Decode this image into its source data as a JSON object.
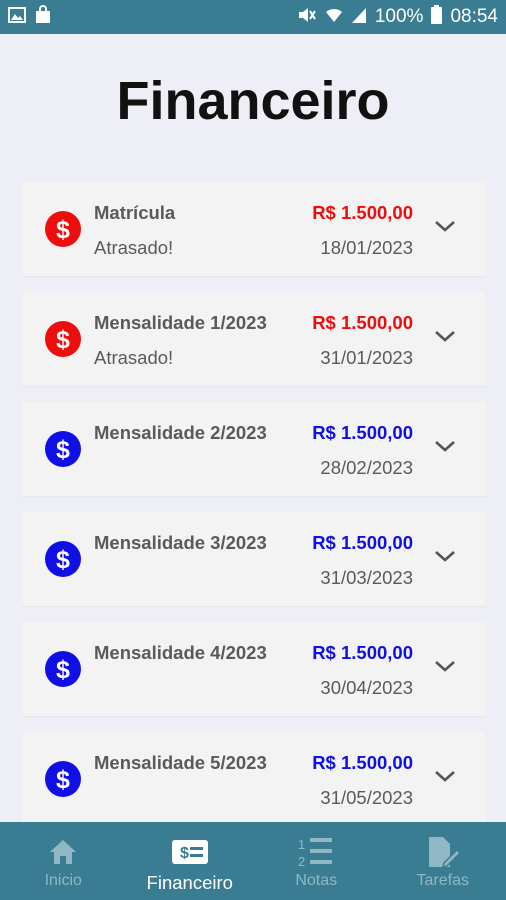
{
  "status_bar": {
    "battery": "100%",
    "time": "08:54"
  },
  "page": {
    "title": "Financeiro"
  },
  "colors": {
    "overdue": "#ee0d0d",
    "pending": "#1010e6"
  },
  "payments": [
    {
      "title": "Matrícula",
      "status": "Atrasado!",
      "amount": "R$ 1.500,00",
      "date": "18/01/2023",
      "state": "overdue"
    },
    {
      "title": "Mensalidade 1/2023",
      "status": "Atrasado!",
      "amount": "R$ 1.500,00",
      "date": "31/01/2023",
      "state": "overdue"
    },
    {
      "title": "Mensalidade 2/2023",
      "status": "",
      "amount": "R$ 1.500,00",
      "date": "28/02/2023",
      "state": "pending"
    },
    {
      "title": "Mensalidade 3/2023",
      "status": "",
      "amount": "R$ 1.500,00",
      "date": "31/03/2023",
      "state": "pending"
    },
    {
      "title": "Mensalidade 4/2023",
      "status": "",
      "amount": "R$ 1.500,00",
      "date": "30/04/2023",
      "state": "pending"
    },
    {
      "title": "Mensalidade 5/2023",
      "status": "",
      "amount": "R$ 1.500,00",
      "date": "31/05/2023",
      "state": "pending"
    }
  ],
  "coin_symbol": "$",
  "nav": {
    "items": [
      {
        "label": "Inicio",
        "icon": "home-icon",
        "active": false
      },
      {
        "label": "Financeiro",
        "icon": "money-bill-icon",
        "active": true
      },
      {
        "label": "Notas",
        "icon": "numbered-list-icon",
        "active": false
      },
      {
        "label": "Tarefas",
        "icon": "task-edit-icon",
        "active": false
      }
    ]
  }
}
